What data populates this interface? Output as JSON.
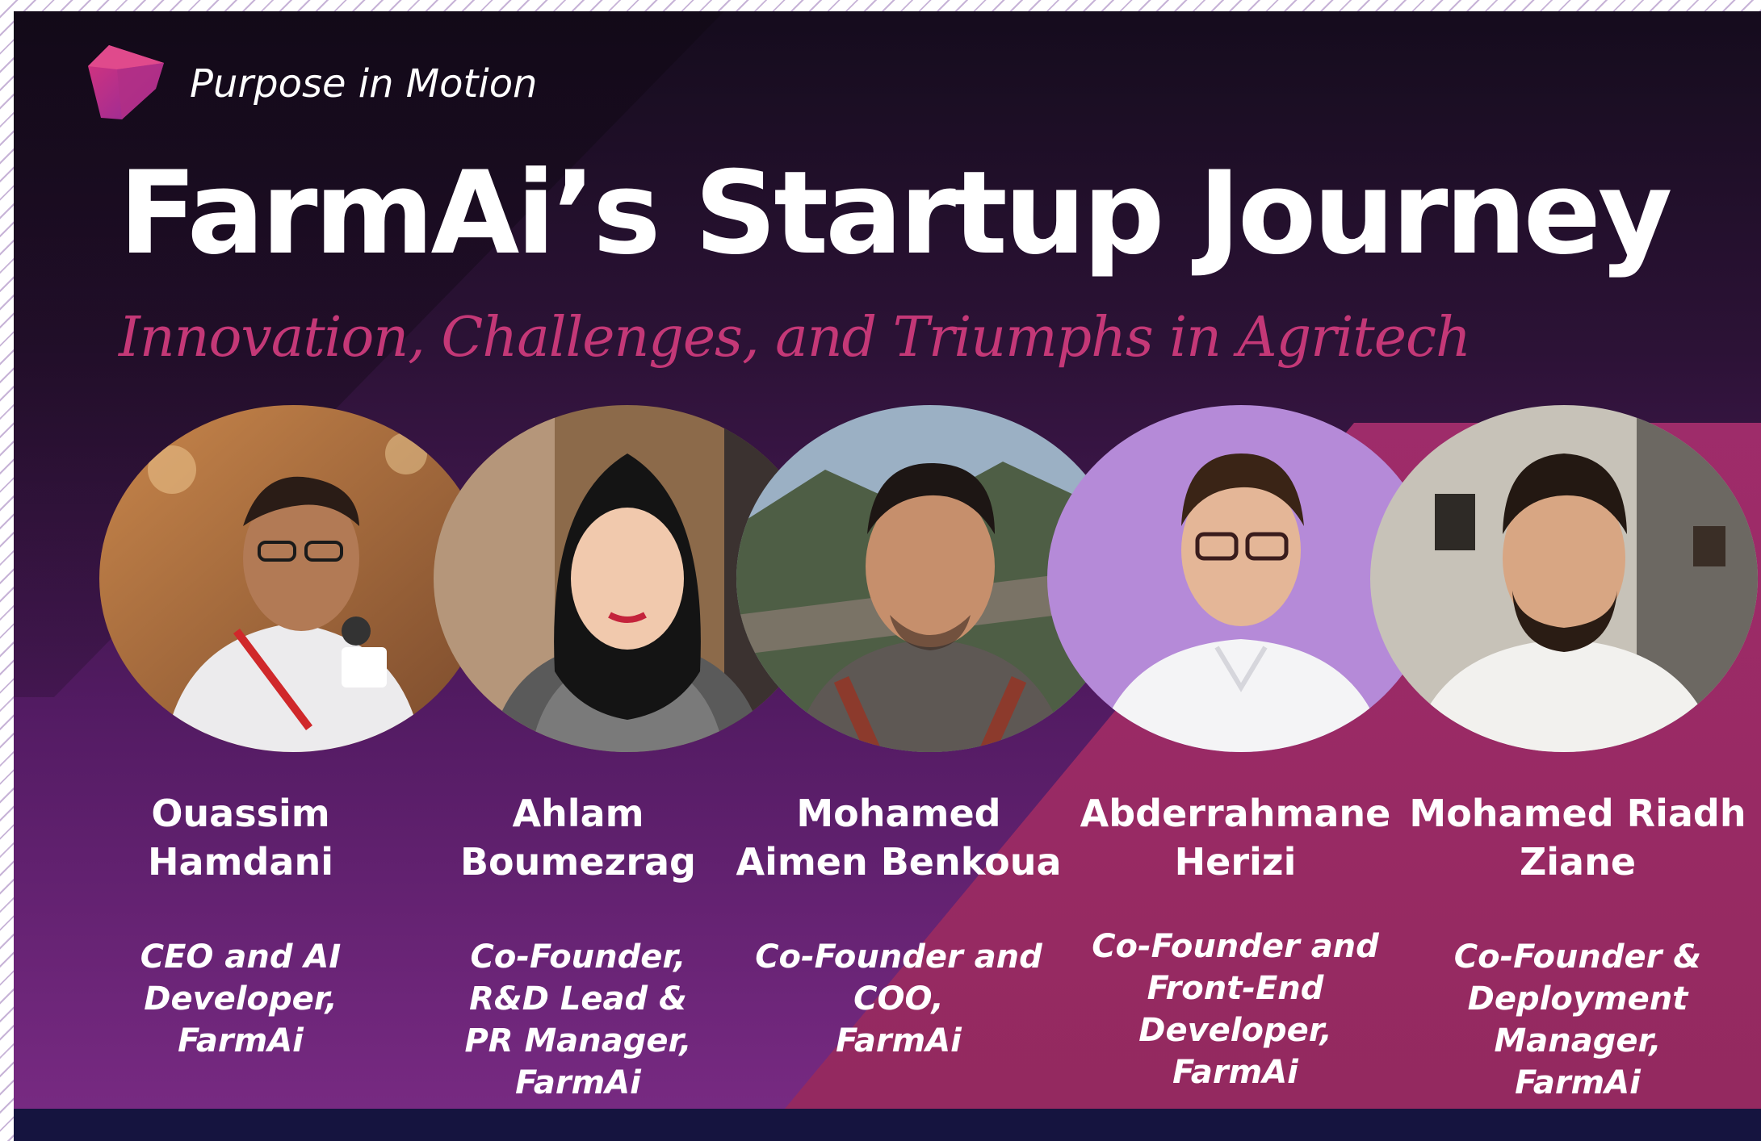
{
  "header": {
    "tagline": "Purpose in Motion",
    "title": "FarmAi’s Startup Journey",
    "subtitle": "Innovation, Challenges, and Triumphs in Agritech"
  },
  "colors": {
    "background_dark": "#150c1d",
    "background_purple": "#7a2b84",
    "accent_pink": "#c43877",
    "band_pink": "#a52d70",
    "bottom_bar": "#15143f",
    "text": "#ffffff"
  },
  "icons": {
    "logo": "logo-icon"
  },
  "members": [
    {
      "name_lines": [
        "Ouassim",
        "Hamdani"
      ],
      "role_lines": [
        "CEO and AI",
        "Developer,",
        "FarmAi"
      ]
    },
    {
      "name_lines": [
        "Ahlam",
        "Boumezrag"
      ],
      "role_lines": [
        "Co-Founder,",
        "R&D Lead &",
        "PR Manager,",
        "FarmAi"
      ]
    },
    {
      "name_lines": [
        "Mohamed",
        "Aimen Benkoua"
      ],
      "role_lines": [
        "Co-Founder and",
        "COO,",
        "FarmAi"
      ]
    },
    {
      "name_lines": [
        "Abderrahmane",
        "Herizi"
      ],
      "role_lines": [
        "Co-Founder and",
        "Front-End",
        "Developer,",
        "FarmAi"
      ]
    },
    {
      "name_lines": [
        "Mohamed Riadh",
        "Ziane"
      ],
      "role_lines": [
        "Co-Founder &",
        "Deployment",
        "Manager,",
        "FarmAi"
      ]
    }
  ]
}
